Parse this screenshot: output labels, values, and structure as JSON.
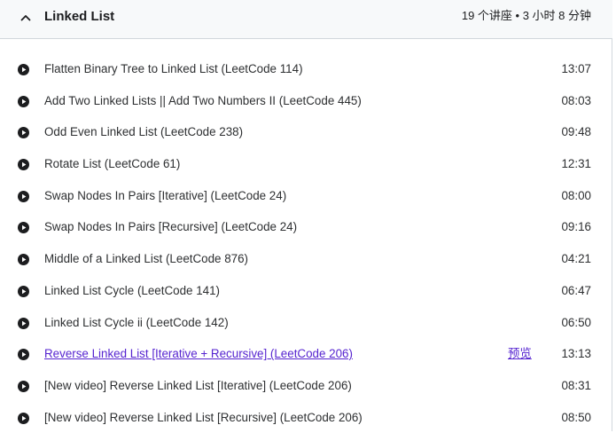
{
  "section": {
    "title": "Linked List",
    "meta": "19 个讲座 • 3 小时 8 分钟",
    "expanded": true
  },
  "colors": {
    "link": "#5624d0",
    "text": "#2d2f31",
    "header_bg": "#f7f9fa",
    "border": "#d1d7dc"
  },
  "lectures": [
    {
      "title": "Flatten Binary Tree to Linked List (LeetCode 114)",
      "duration": "13:07",
      "preview": ""
    },
    {
      "title": "Add Two Linked Lists || Add Two Numbers II (LeetCode 445)",
      "duration": "08:03",
      "preview": ""
    },
    {
      "title": "Odd Even Linked List (LeetCode 238)",
      "duration": "09:48",
      "preview": ""
    },
    {
      "title": "Rotate List (LeetCode 61)",
      "duration": "12:31",
      "preview": ""
    },
    {
      "title": "Swap Nodes In Pairs [Iterative] (LeetCode 24)",
      "duration": "08:00",
      "preview": ""
    },
    {
      "title": "Swap Nodes In Pairs [Recursive] (LeetCode 24)",
      "duration": "09:16",
      "preview": ""
    },
    {
      "title": "Middle of a Linked List (LeetCode 876)",
      "duration": "04:21",
      "preview": ""
    },
    {
      "title": "Linked List Cycle (LeetCode 141)",
      "duration": "06:47",
      "preview": ""
    },
    {
      "title": "Linked List Cycle ii (LeetCode 142)",
      "duration": "06:50",
      "preview": ""
    },
    {
      "title": "Reverse Linked List [Iterative + Recursive] (LeetCode 206)",
      "duration": "13:13",
      "preview": "预览"
    },
    {
      "title": "[New video] Reverse Linked List [Iterative] (LeetCode 206)",
      "duration": "08:31",
      "preview": ""
    },
    {
      "title": "[New video] Reverse Linked List [Recursive] (LeetCode 206)",
      "duration": "08:50",
      "preview": ""
    }
  ]
}
